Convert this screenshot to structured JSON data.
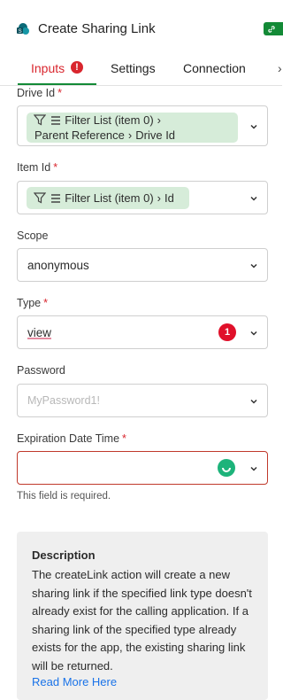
{
  "header": {
    "title": "Create Sharing Link",
    "icon": "sharepoint-app-icon",
    "badge_icon": "link-icon",
    "badge_color": "#138a36"
  },
  "tabs": [
    {
      "label": "Inputs",
      "active": true,
      "error_icon": "!"
    },
    {
      "label": "Settings"
    },
    {
      "label": "Connection"
    }
  ],
  "fields": {
    "drive_id": {
      "label": "Drive Id",
      "required": "*",
      "chip_line1": "Filter List (item 0)",
      "chip_line2a": "Parent Reference",
      "chip_line2b": "Drive Id"
    },
    "item_id": {
      "label": "Item Id",
      "required": "*",
      "chip_text": "Filter List (item 0)",
      "chip_tail": "Id"
    },
    "scope": {
      "label": "Scope",
      "value": "anonymous"
    },
    "type": {
      "label": "Type",
      "required": "*",
      "value": "view",
      "badge": "1"
    },
    "password": {
      "label": "Password",
      "placeholder": "MyPassword1!"
    },
    "expiration": {
      "label": "Expiration Date Time",
      "required": "*",
      "help": "This field is required."
    }
  },
  "description": {
    "title": "Description",
    "body": "The createLink action will create a new sharing link if the specified link type doesn't already exist for the calling application. If a sharing link of the specified type already exists for the app, the existing sharing link will be returned.",
    "link": "Read More Here"
  },
  "colors": {
    "accent": "#138a36",
    "error": "#d9262e",
    "chip": "#d6ecd9"
  }
}
